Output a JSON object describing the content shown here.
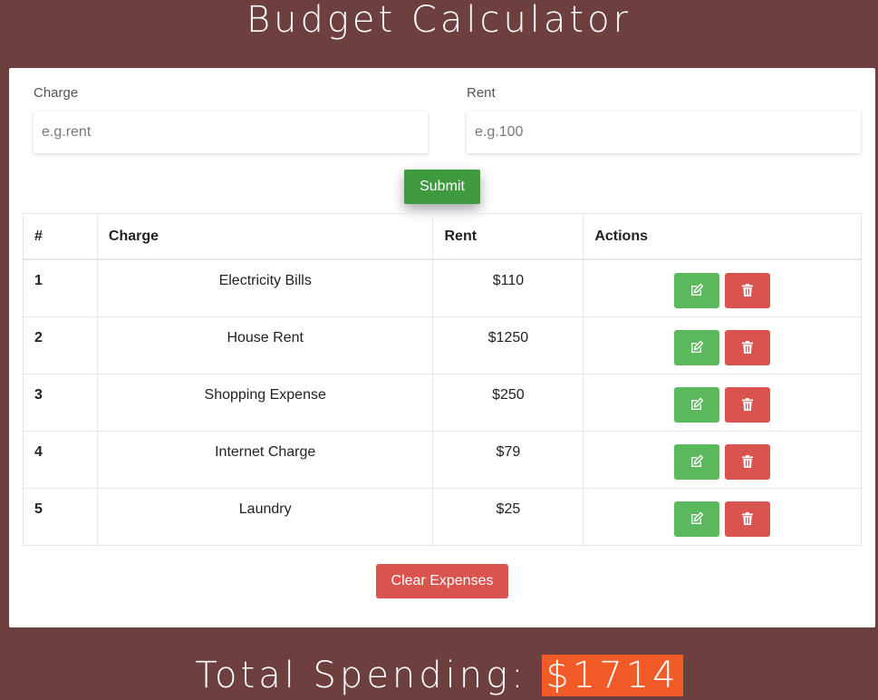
{
  "app": {
    "title": "Budget Calculator"
  },
  "form": {
    "charge_label": "Charge",
    "charge_placeholder": "e.g.rent",
    "rent_label": "Rent",
    "rent_placeholder": "e.g.100",
    "submit_label": "Submit"
  },
  "table": {
    "headers": [
      "#",
      "Charge",
      "Rent",
      "Actions"
    ],
    "rows": [
      {
        "num": "1",
        "charge": "Electricity Bills",
        "rent": "$110"
      },
      {
        "num": "2",
        "charge": "House Rent",
        "rent": "$1250"
      },
      {
        "num": "3",
        "charge": "Shopping Expense",
        "rent": "$250"
      },
      {
        "num": "4",
        "charge": "Internet Charge",
        "rent": "$79"
      },
      {
        "num": "5",
        "charge": "Laundry",
        "rent": "$25"
      }
    ],
    "row_actions": [
      "edit-icon",
      "trash-icon"
    ]
  },
  "clear_label": "Clear Expenses",
  "total": {
    "label": "Total Spending:",
    "amount": "$1714"
  },
  "colors": {
    "background": "#6d3f3f",
    "submit": "#3f9a3f",
    "edit": "#5cb85c",
    "delete": "#d9534f",
    "total_highlight": "#f25a27"
  }
}
